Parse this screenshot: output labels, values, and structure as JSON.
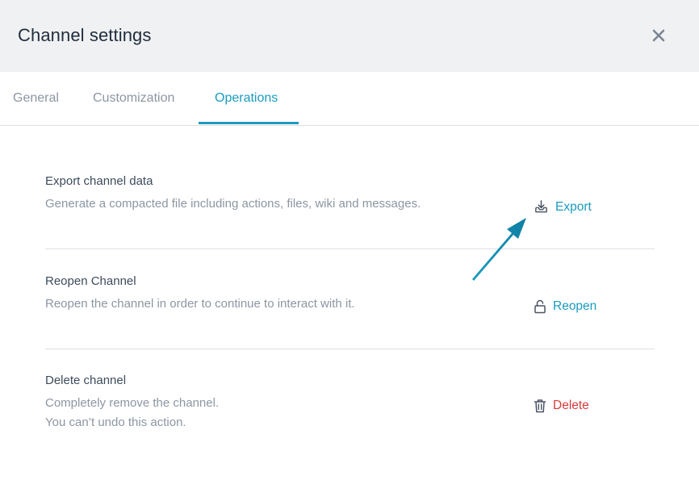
{
  "header": {
    "title": "Channel settings",
    "close_icon": "close-icon"
  },
  "tabs": [
    {
      "label": "General",
      "active": false
    },
    {
      "label": "Customization",
      "active": false
    },
    {
      "label": "Operations",
      "active": true
    }
  ],
  "sections": [
    {
      "title": "Export channel data",
      "description": [
        "Generate a compacted file including actions, files, wiki and messages."
      ],
      "action": {
        "label": "Export",
        "icon": "download-tray-icon",
        "color": "#1a9bbd"
      }
    },
    {
      "title": "Reopen Channel",
      "description": [
        "Reopen the channel in order to continue to interact with it."
      ],
      "action": {
        "label": "Reopen",
        "icon": "unlock-icon",
        "color": "#1a9bbd"
      }
    },
    {
      "title": "Delete channel",
      "description": [
        "Completely remove the channel.",
        "You can’t undo this action."
      ],
      "action": {
        "label": "Delete",
        "icon": "trash-icon",
        "color": "#d93b3b"
      }
    }
  ],
  "colors": {
    "accent": "#1a9bbd",
    "danger": "#d93b3b",
    "header_bg": "#f0f1f3",
    "annotation_arrow": "#1a9bbd"
  }
}
